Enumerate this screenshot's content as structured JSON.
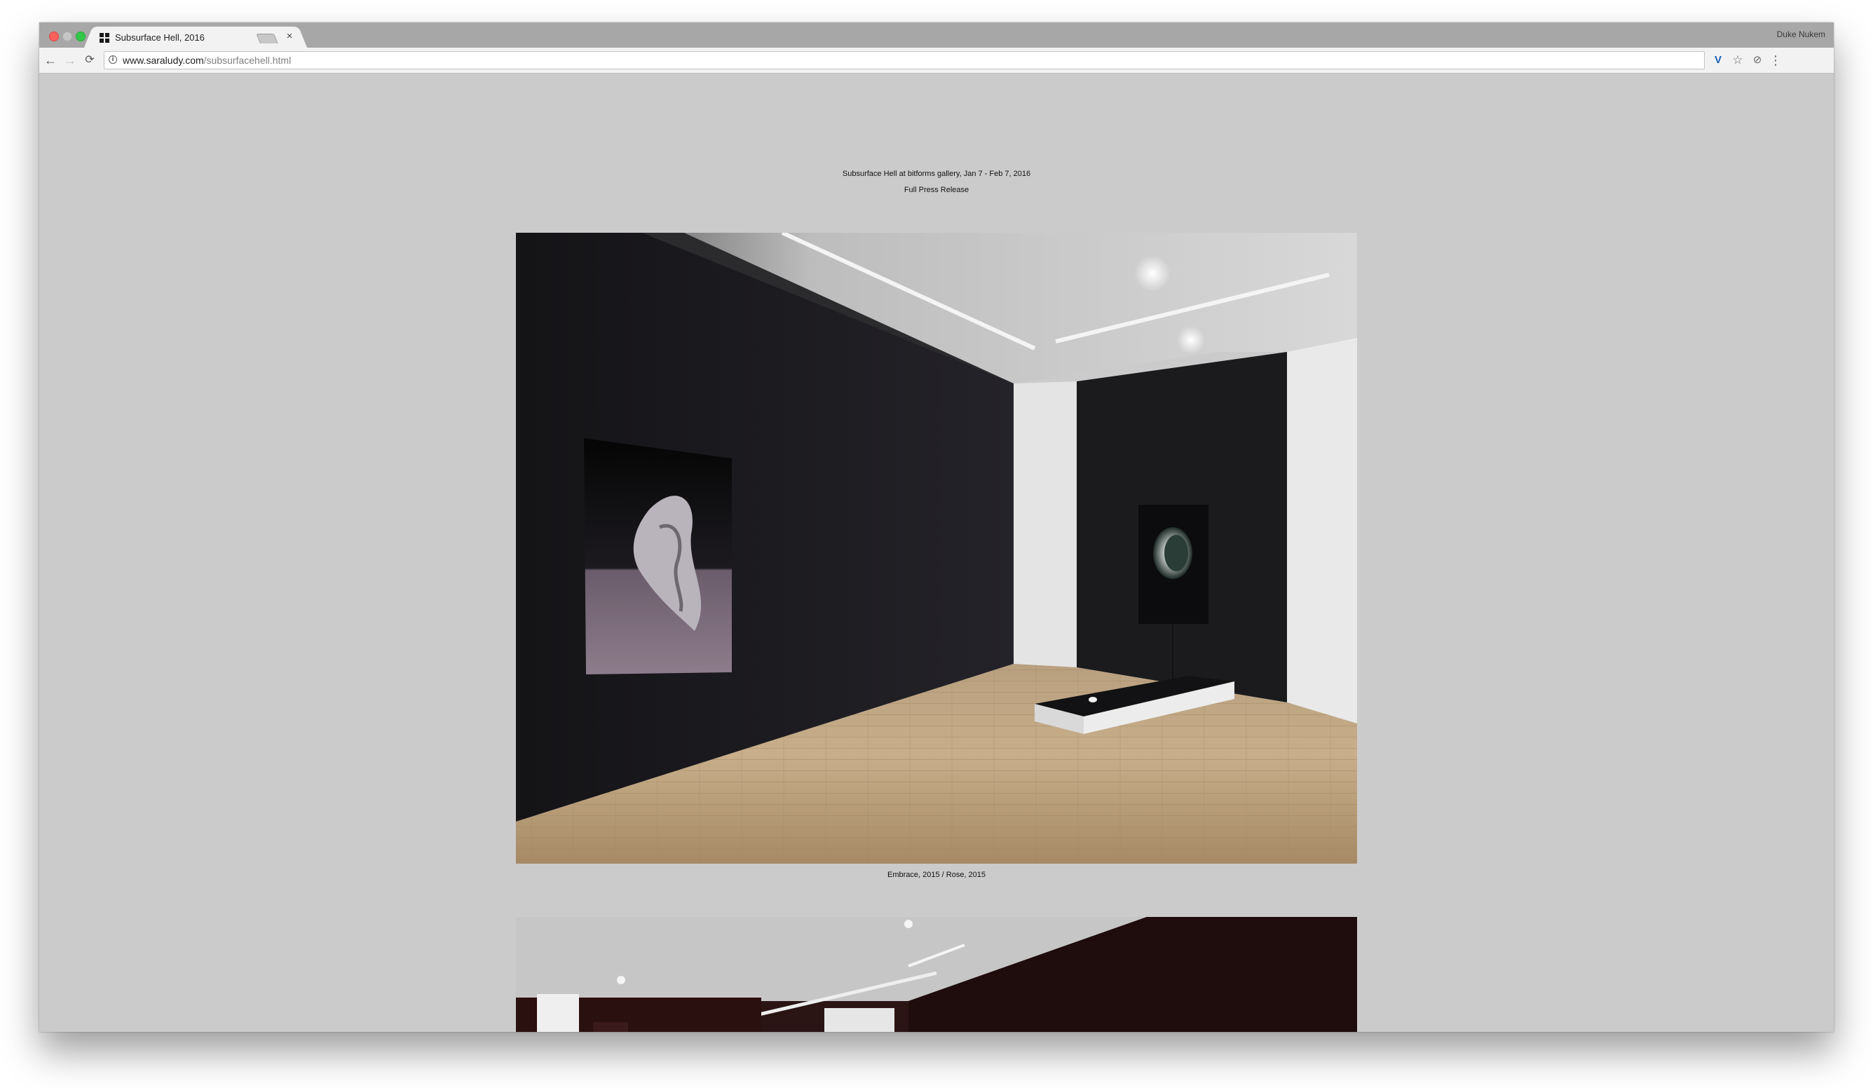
{
  "browser": {
    "tab": {
      "title": "Subsurface Hell, 2016",
      "close_glyph": "×"
    },
    "profile_name": "Duke Nukem",
    "address": {
      "host": "www.saraludy.com",
      "path": "/subsurfacehell.html"
    },
    "icons": {
      "back": "←",
      "forward": "→",
      "reload": "⟳",
      "info": "i",
      "extension_v": "V",
      "bookmark": "☆",
      "extension_2": "⊘",
      "menu": "⋮"
    }
  },
  "page": {
    "headline": "Subsurface Hell at bitforms gallery, Jan 7 - Feb 7, 2016",
    "press_link": "Full Press Release",
    "images": [
      {
        "caption": "Embrace, 2015 / Rose, 2015"
      },
      {
        "caption": ""
      }
    ]
  }
}
